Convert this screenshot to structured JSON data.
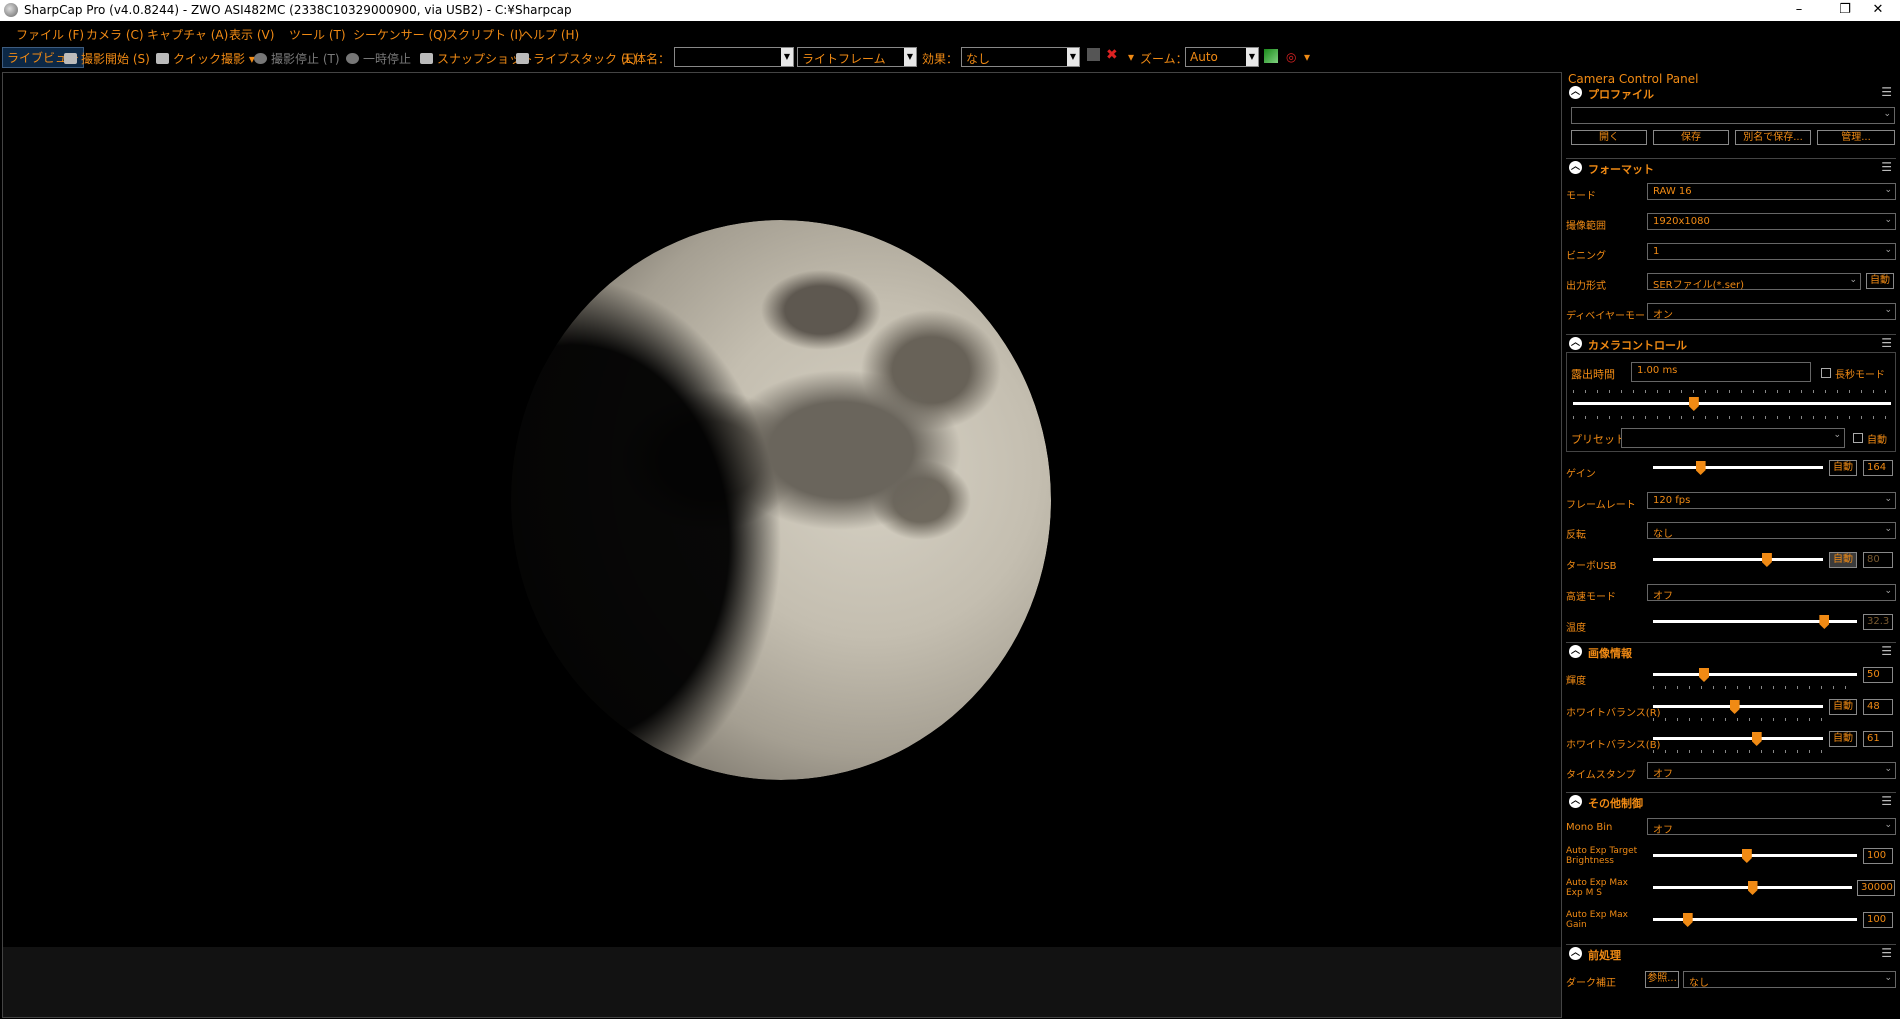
{
  "window": {
    "title": "SharpCap Pro (v4.0.8244) - ZWO ASI482MC (2338C10329000900, via USB2) - C:¥Sharpcap",
    "minimize": "–",
    "maximize": "❐",
    "close": "✕"
  },
  "menu": [
    "ファイル (F)",
    "カメラ (C)",
    "キャプチャ (A)",
    "表示 (V)",
    "ツール (T)",
    "シーケンサー (Q)",
    "スクリプト (I)",
    "ヘルプ (H)"
  ],
  "toolbar": {
    "live_view": "ライブビュー",
    "start_capture": "撮影開始 (S)",
    "quick_capture": "クイック撮影",
    "stop_capture": "撮影停止 (T)",
    "pause": "一時停止",
    "snapshot": "スナップショット",
    "live_stack": "ライブスタック (L)",
    "target_label": "天体名：",
    "target_value": "",
    "frame_type": "ライトフレーム",
    "effect_label": "効果：",
    "effect_value": "なし",
    "zoom_label": "ズーム：",
    "zoom_value": "Auto"
  },
  "panel": {
    "title": "Camera Control Panel",
    "profile": {
      "title": "プロファイル",
      "value": "",
      "buttons": [
        "開く",
        "保存",
        "別名で保存...",
        "管理..."
      ]
    },
    "format": {
      "title": "フォーマット",
      "rows": [
        {
          "label": "モード",
          "value": "RAW 16"
        },
        {
          "label": "撮像範囲",
          "value": "1920x1080"
        },
        {
          "label": "ビニング",
          "value": "1"
        },
        {
          "label": "出力形式",
          "value": "SERファイル(*.ser)",
          "auto": "自動"
        },
        {
          "label": "ディベイヤーモード",
          "value": "オン"
        }
      ]
    },
    "camera": {
      "title": "カメラコントロール",
      "exposure_label": "露出時間",
      "exposure_value": "1.00 ms",
      "long_mode": "長秒モード",
      "exposure_level": 0.38,
      "preset_label": "プリセット",
      "preset_value": "",
      "preset_auto": "自動",
      "gain_label": "ゲイン",
      "gain_auto": "自動",
      "gain_value": "164",
      "gain_level": 0.28,
      "framerate_label": "フレームレート",
      "framerate_value": "120 fps",
      "flip_label": "反転",
      "flip_value": "なし",
      "turbo_label": "ターボUSB",
      "turbo_auto": "自動",
      "turbo_value": "80",
      "turbo_level": 0.67,
      "highspeed_label": "高速モード",
      "highspeed_value": "オフ",
      "temp_label": "温度",
      "temp_value": "32.3",
      "temp_level": 0.84
    },
    "image": {
      "title": "画像情報",
      "brightness_label": "輝度",
      "brightness_value": "50",
      "brightness_level": 0.25,
      "wbr_label": "ホワイトバランス(R)",
      "wbr_auto": "自動",
      "wbr_value": "48",
      "wbr_level": 0.48,
      "wbb_label": "ホワイトバランス(B)",
      "wbb_auto": "自動",
      "wbb_value": "61",
      "wbb_level": 0.61,
      "timestamp_label": "タイムスタンプ",
      "timestamp_value": "オフ"
    },
    "misc": {
      "title": "その他制御",
      "monobin_label": "Mono Bin",
      "monobin_value": "オフ",
      "aet_label": "Auto Exp Target Brightness",
      "aet_value": "100",
      "aet_level": 0.46,
      "aem_label": "Auto Exp Max Exp M S",
      "aem_value": "30000",
      "aem_level": 0.5,
      "aeg_label": "Auto Exp Max Gain",
      "aeg_value": "100",
      "aeg_level": 0.17
    },
    "pre": {
      "title": "前処理",
      "dark_label": "ダーク補正",
      "dark_browse": "参照...",
      "dark_value": "なし"
    }
  }
}
